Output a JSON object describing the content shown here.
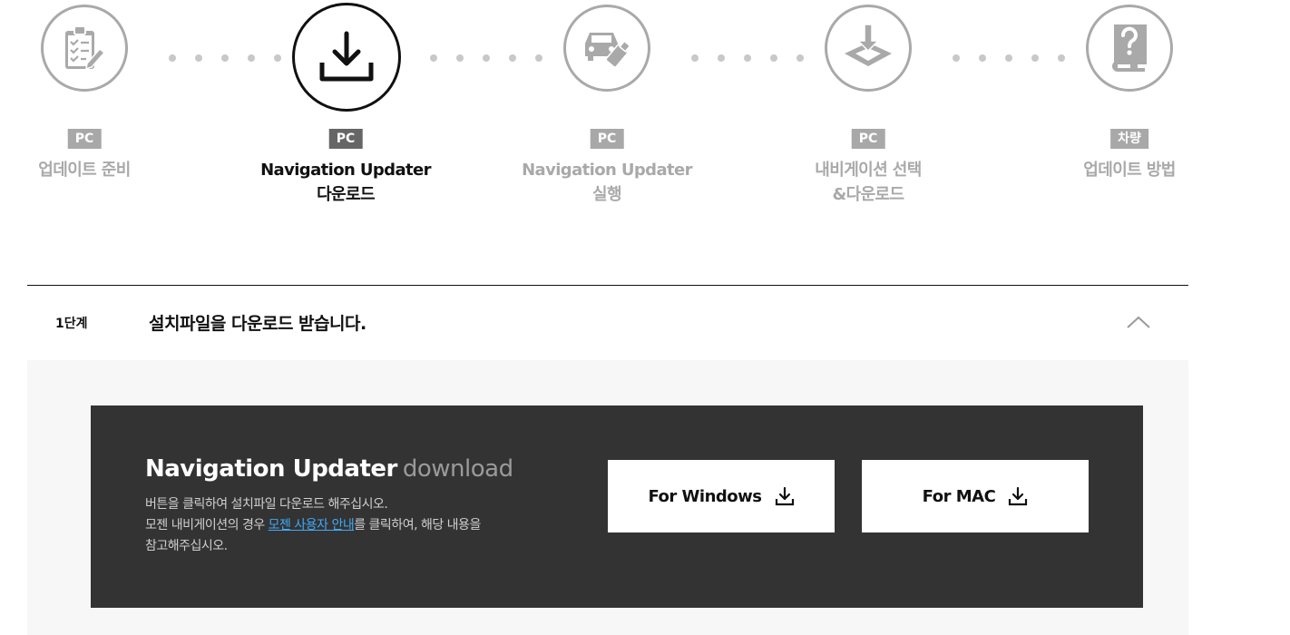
{
  "steps": [
    {
      "badge": "PC",
      "line1": "업데이트 준비",
      "line2": "",
      "icon": "checklist-icon",
      "active": false
    },
    {
      "badge": "PC",
      "line1": "Navigation Updater",
      "line2": "다운로드",
      "icon": "download-icon",
      "active": true
    },
    {
      "badge": "PC",
      "line1": "Navigation Updater",
      "line2": "실행",
      "icon": "car-usb-icon",
      "active": false
    },
    {
      "badge": "PC",
      "line1": "내비게이션 선택",
      "line2": "&다운로드",
      "icon": "map-download-icon",
      "active": false
    },
    {
      "badge": "차량",
      "line1": "업데이트 방법",
      "line2": "",
      "icon": "help-book-icon",
      "active": false
    }
  ],
  "accordion": {
    "step_label": "1단계",
    "title": "설치파일을 다운로드 받습니다.",
    "expanded": true
  },
  "download": {
    "title_bold": "Navigation Updater",
    "title_light": "download",
    "desc_line1": "버튼을 클릭하여 설치파일 다운로드 해주십시오.",
    "desc_line2_before": "모젠 내비게이션의 경우 ",
    "desc_link": "모젠 사용자 안내",
    "desc_line2_after": "를 클릭하여, 해당 내용을",
    "desc_line3": "참고해주십시오.",
    "windows_label": "For Windows",
    "mac_label": "For MAC"
  },
  "colors": {
    "accent_link": "#3fa9f5",
    "panel_bg": "#333333",
    "inactive": "#a9a9a9"
  }
}
